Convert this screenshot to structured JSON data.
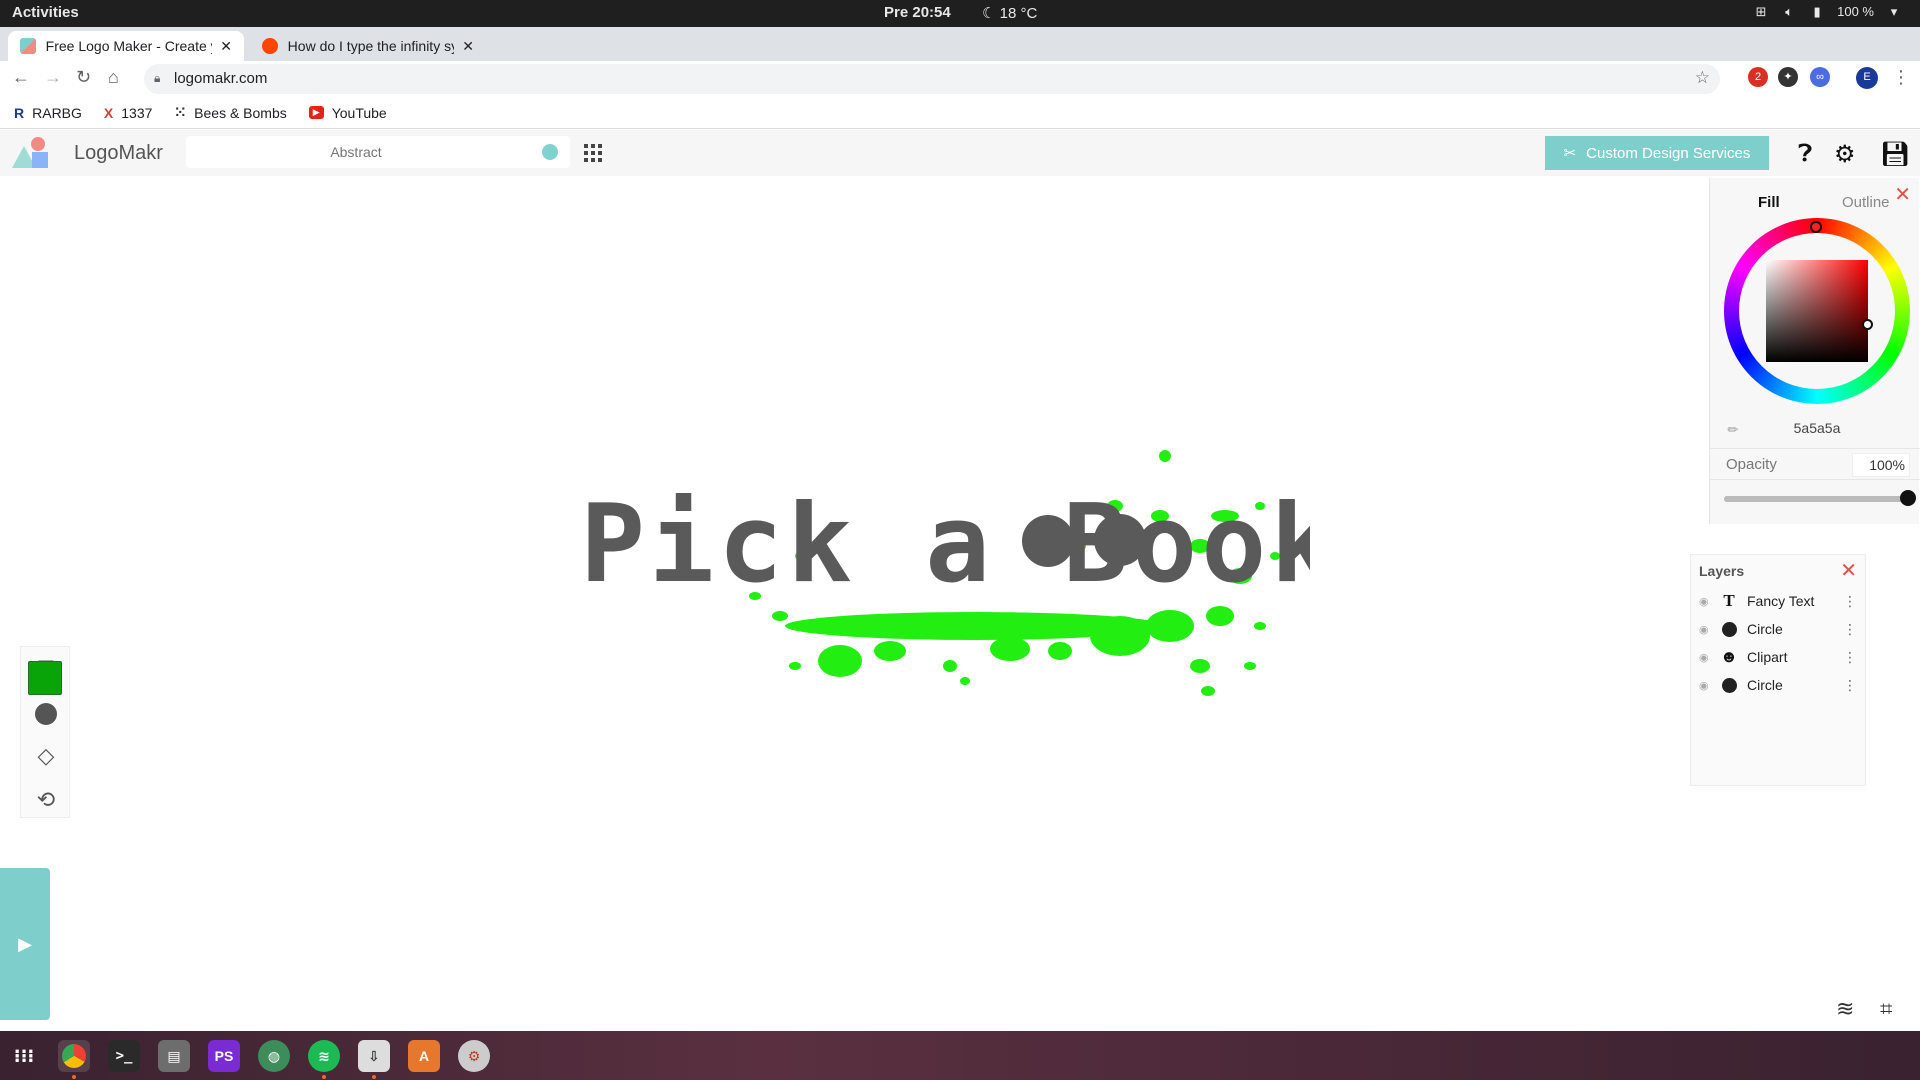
{
  "system": {
    "activities": "Activities",
    "clock": "Pre 20:54",
    "weather": "18 °C",
    "battery": "100 %"
  },
  "browser": {
    "tabs": [
      {
        "title": "Free Logo Maker - Create your own logo",
        "active": true
      },
      {
        "title": "How do I type the infinity symbol",
        "active": false
      }
    ],
    "url": "logomakr.com",
    "bookmarks": [
      {
        "icon": "R",
        "label": "RARBG"
      },
      {
        "icon": "X",
        "label": "1337"
      },
      {
        "icon": "⁙",
        "label": "Bees & Bombs"
      },
      {
        "icon": "▶",
        "label": "YouTube"
      }
    ],
    "profile_initial": "E",
    "extension_badge": "2"
  },
  "app": {
    "name": "LogoMakr",
    "search_placeholder": "Abstract",
    "custom_design_label": "Custom Design Services"
  },
  "canvas": {
    "logo_text": "Pick a Book",
    "text_color": "#5a5a5a",
    "splash_color": "#22ee11"
  },
  "color_picker": {
    "tab_fill": "Fill",
    "tab_outline": "Outline",
    "hex_value": "5a5a5a",
    "opacity_label": "Opacity",
    "opacity_value": "100%",
    "opacity_fraction": 1.0
  },
  "layers": {
    "title": "Layers",
    "items": [
      {
        "name": "Fancy Text",
        "type": "text"
      },
      {
        "name": "Circle",
        "type": "circle"
      },
      {
        "name": "Clipart",
        "type": "clipart"
      },
      {
        "name": "Circle",
        "type": "circle"
      }
    ]
  },
  "colors": {
    "accent": "#7ecfcc",
    "swatch": "#08a408",
    "close_red": "#e0524a"
  }
}
